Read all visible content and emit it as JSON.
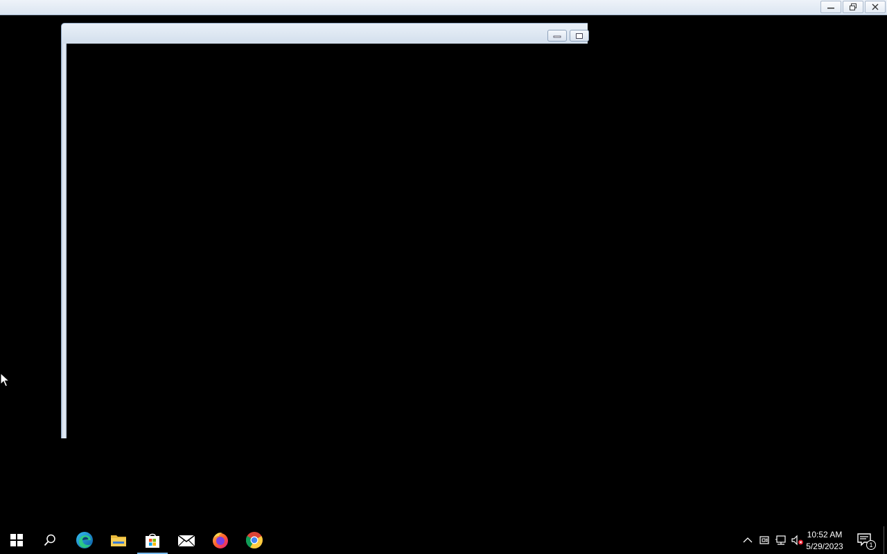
{
  "taskbar": {
    "pinned": [
      {
        "name": "start-icon"
      },
      {
        "name": "search-icon"
      },
      {
        "name": "edge-icon"
      },
      {
        "name": "file-explorer-icon"
      },
      {
        "name": "store-icon",
        "active": true
      },
      {
        "name": "mail-icon"
      },
      {
        "name": "firefox-icon"
      },
      {
        "name": "chrome-icon"
      }
    ],
    "tray": {
      "time": "10:52 AM",
      "date": "5/29/2023",
      "notification_count": "1"
    }
  },
  "colors": {
    "accent_underline": "#76b9ed",
    "desktop_background": "#000000"
  }
}
